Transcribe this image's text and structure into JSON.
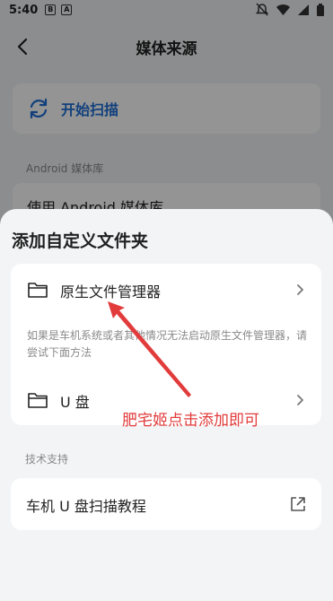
{
  "status_bar": {
    "time": "5:40",
    "mini_icon_1": "B",
    "mini_icon_2": "A"
  },
  "header": {
    "title": "媒体来源"
  },
  "scan_card": {
    "label": "开始扫描"
  },
  "android_section": {
    "label": "Android 媒体库",
    "item_label": "使用 Android 媒体库"
  },
  "sheet": {
    "title": "添加自定义文件夹",
    "options": {
      "native": {
        "label": "原生文件管理器"
      },
      "hint": "如果是车机系统或者其他情况无法启动原生文件管理器，请尝试下面方法",
      "udisk": {
        "label": "U 盘"
      }
    },
    "support_section": {
      "label": "技术支持"
    },
    "tutorial": {
      "label": "车机 U 盘扫描教程"
    }
  },
  "annotation": {
    "text": "肥宅姬点击添加即可",
    "color": "#e23b3b"
  },
  "colors": {
    "accent": "#1f6fd6",
    "sheet_bg": "#f3f4f6",
    "annotation": "#e23b3b"
  },
  "icons": [
    "back-arrow-icon",
    "refresh-icon",
    "folder-icon",
    "chevron-right-icon",
    "external-link-icon",
    "silent-icon",
    "wifi-icon",
    "signal-icon",
    "battery-icon"
  ]
}
